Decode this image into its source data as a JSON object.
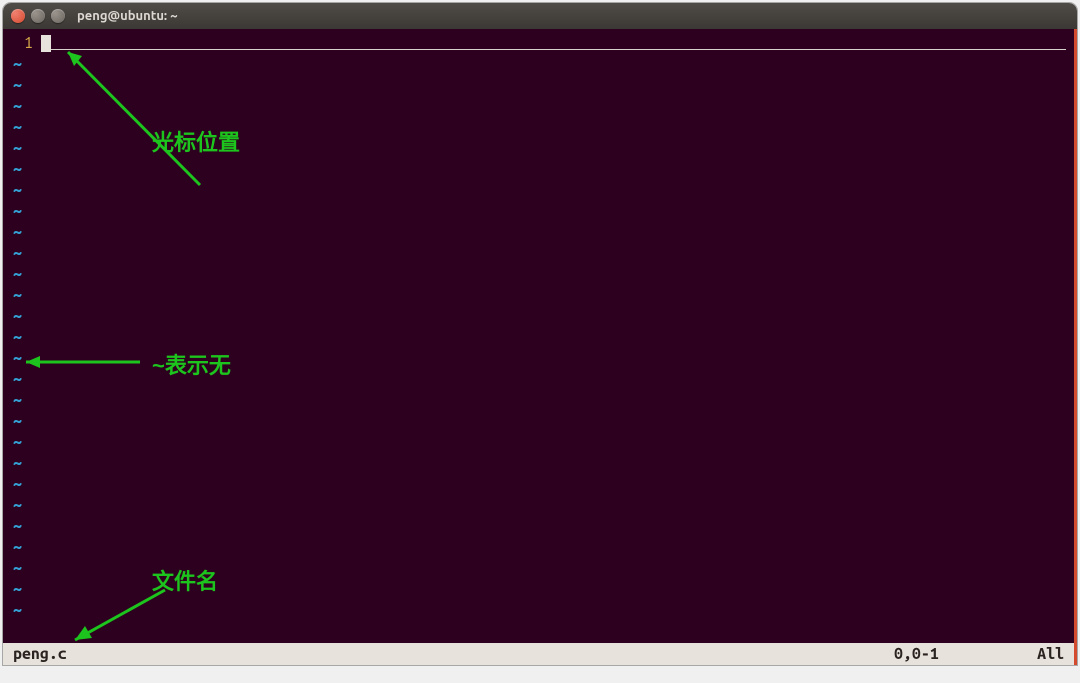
{
  "titlebar": {
    "title": "peng@ubuntu: ~"
  },
  "editor": {
    "line_number": "1",
    "tilde_char": "~",
    "tilde_count": 27
  },
  "status": {
    "filename": "peng.c",
    "position": "0,0-1",
    "scroll": "All"
  },
  "annotations": {
    "cursor_label": "光标位置",
    "tilde_label": "~表示无",
    "filename_label": "文件名"
  }
}
